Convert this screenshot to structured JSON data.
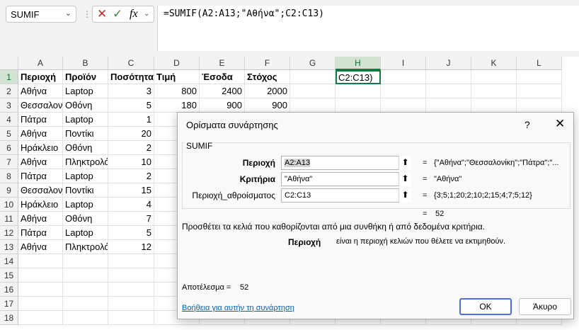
{
  "formula_bar": {
    "name_box": "SUMIF",
    "formula": "=SUMIF(A2:A13;\"Αθήνα\";C2:C13)"
  },
  "sheet": {
    "columns": [
      "A",
      "B",
      "C",
      "D",
      "E",
      "F",
      "G",
      "H",
      "I",
      "J",
      "K",
      "L"
    ],
    "rows": [
      "1",
      "2",
      "3",
      "4",
      "5",
      "6",
      "7",
      "8",
      "9",
      "10",
      "11",
      "12",
      "13",
      "14",
      "15",
      "16",
      "17",
      "18"
    ],
    "headers": [
      "Περιοχή",
      "Προϊόν",
      "Ποσότητα",
      "Τιμή",
      "Έσοδα",
      "Στόχος"
    ],
    "data": [
      {
        "a": "Αθήνα",
        "b": "Laptop",
        "c": "3",
        "d": "800",
        "e": "2400",
        "f": "2000"
      },
      {
        "a": "Θεσσαλονίκη",
        "b": "Οθόνη",
        "c": "5",
        "d": "180",
        "e": "900",
        "f": "900"
      },
      {
        "a": "Πάτρα",
        "b": "Laptop",
        "c": "1"
      },
      {
        "a": "Αθήνα",
        "b": "Ποντίκι",
        "c": "20"
      },
      {
        "a": "Ηράκλειο",
        "b": "Οθόνη",
        "c": "2"
      },
      {
        "a": "Αθήνα",
        "b": "Πληκτρολόγιο",
        "c": "10"
      },
      {
        "a": "Πάτρα",
        "b": "Laptop",
        "c": "2"
      },
      {
        "a": "Θεσσαλονίκη",
        "b": "Ποντίκι",
        "c": "15"
      },
      {
        "a": "Ηράκλειο",
        "b": "Laptop",
        "c": "4"
      },
      {
        "a": "Αθήνα",
        "b": "Οθόνη",
        "c": "7"
      },
      {
        "a": "Πάτρα",
        "b": "Laptop",
        "c": "5"
      },
      {
        "a": "Αθήνα",
        "b": "Πληκτρολόγιο",
        "c": "12"
      }
    ],
    "active_cell": {
      "ref": "H1",
      "text": "C2:C13)"
    }
  },
  "dialog": {
    "title": "Ορίσματα συνάρτησης",
    "help_glyph": "?",
    "close_glyph": "✕",
    "function_name": "SUMIF",
    "args": [
      {
        "label": "Περιοχή",
        "value": "A2:A13",
        "result": "{\"Αθήνα\";\"Θεσσαλονίκη\";\"Πάτρα\";\"..."
      },
      {
        "label": "Κριτήρια",
        "value": "\"Αθήνα\"",
        "result": "\"Αθήνα\""
      },
      {
        "label": "Περιοχή_αθροίσματος",
        "value": "C2:C13",
        "result": "{3;5;1;20;2;10;2;15;4;7;5;12}"
      }
    ],
    "equals": "=",
    "function_result": "52",
    "description": "Προσθέτει τα κελιά που καθορίζονται από μια συνθήκη ή από δεδομένα κριτήρια.",
    "arg_desc_name": "Περιοχή",
    "arg_desc_text": "είναι η περιοχή κελιών που θέλετε να εκτιμηθούν.",
    "formula_result_label": "Αποτέλεσμα =",
    "formula_result_value": "52",
    "help_link": "Βοήθεια για αυτήν τη συνάρτηση",
    "ok_label": "OK",
    "cancel_label": "Άκυρο"
  },
  "icons": {
    "ref_button": "collapse-dialog-icon",
    "cancel": "cancel-icon",
    "enter": "check-icon",
    "fx": "insert-function-icon"
  }
}
